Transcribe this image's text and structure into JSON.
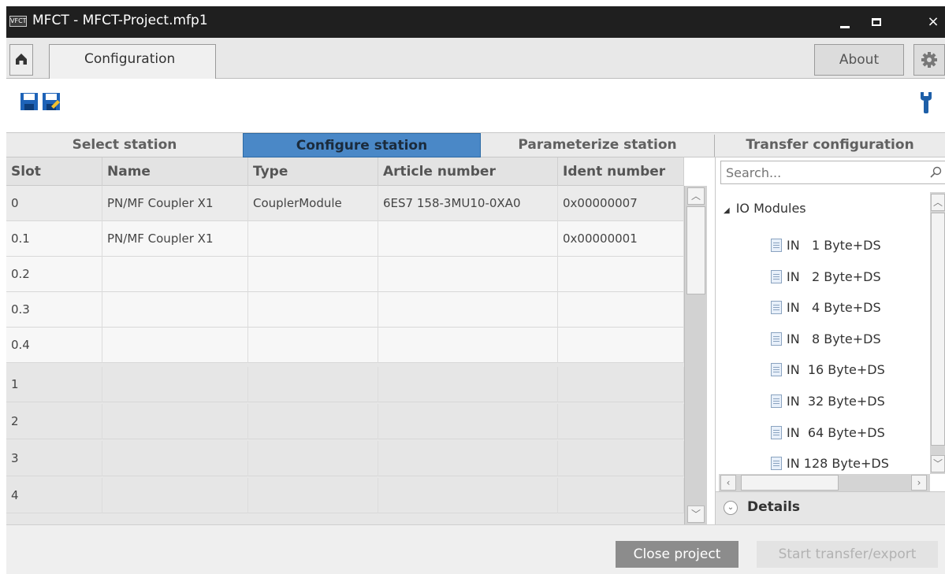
{
  "window": {
    "app_icon_text": "VFCT",
    "title": "MFCT - MFCT-Project.mfp1",
    "minimize_label": "minimize",
    "maximize_label": "maximize",
    "close_label": "×"
  },
  "tabbar": {
    "home_icon": "home-icon",
    "active_tab": "Configuration",
    "about_label": "About",
    "gear_icon": "gear-icon"
  },
  "toolbar": {
    "icons": [
      "save-icon",
      "save-as-icon",
      "wrench-icon"
    ]
  },
  "steps": [
    {
      "label": "Select station",
      "active": false
    },
    {
      "label": "Configure station",
      "active": true
    },
    {
      "label": "Parameterize station",
      "active": false
    },
    {
      "label": "Transfer configuration",
      "active": false
    }
  ],
  "grid": {
    "columns": [
      "Slot",
      "Name",
      "Type",
      "Article number",
      "Ident number"
    ],
    "rows": [
      {
        "slot": "0",
        "name": "PN/MF Coupler X1",
        "type": "CouplerModule",
        "article": "6ES7 158-3MU10-0XA0",
        "ident": "0x00000007"
      },
      {
        "slot": "0.1",
        "name": "PN/MF Coupler X1",
        "type": "",
        "article": "",
        "ident": "0x00000001"
      },
      {
        "slot": "0.2",
        "name": "",
        "type": "",
        "article": "",
        "ident": ""
      },
      {
        "slot": "0.3",
        "name": "",
        "type": "",
        "article": "",
        "ident": ""
      },
      {
        "slot": "0.4",
        "name": "",
        "type": "",
        "article": "",
        "ident": ""
      },
      {
        "slot": "1",
        "name": "",
        "type": "",
        "article": "",
        "ident": ""
      },
      {
        "slot": "2",
        "name": "",
        "type": "",
        "article": "",
        "ident": ""
      },
      {
        "slot": "3",
        "name": "",
        "type": "",
        "article": "",
        "ident": ""
      },
      {
        "slot": "4",
        "name": "",
        "type": "",
        "article": "",
        "ident": ""
      }
    ]
  },
  "catalog": {
    "search_placeholder": "Search...",
    "search_icon": "search-icon",
    "group": "IO Modules",
    "items": [
      "IN   1 Byte+DS",
      "IN   2 Byte+DS",
      "IN   4 Byte+DS",
      "IN   8 Byte+DS",
      "IN  16 Byte+DS",
      "IN  32 Byte+DS",
      "IN  64 Byte+DS",
      "IN 128 Byte+DS"
    ],
    "details_label": "Details"
  },
  "footer": {
    "close_project": "Close project",
    "start_transfer": "Start transfer/export"
  }
}
